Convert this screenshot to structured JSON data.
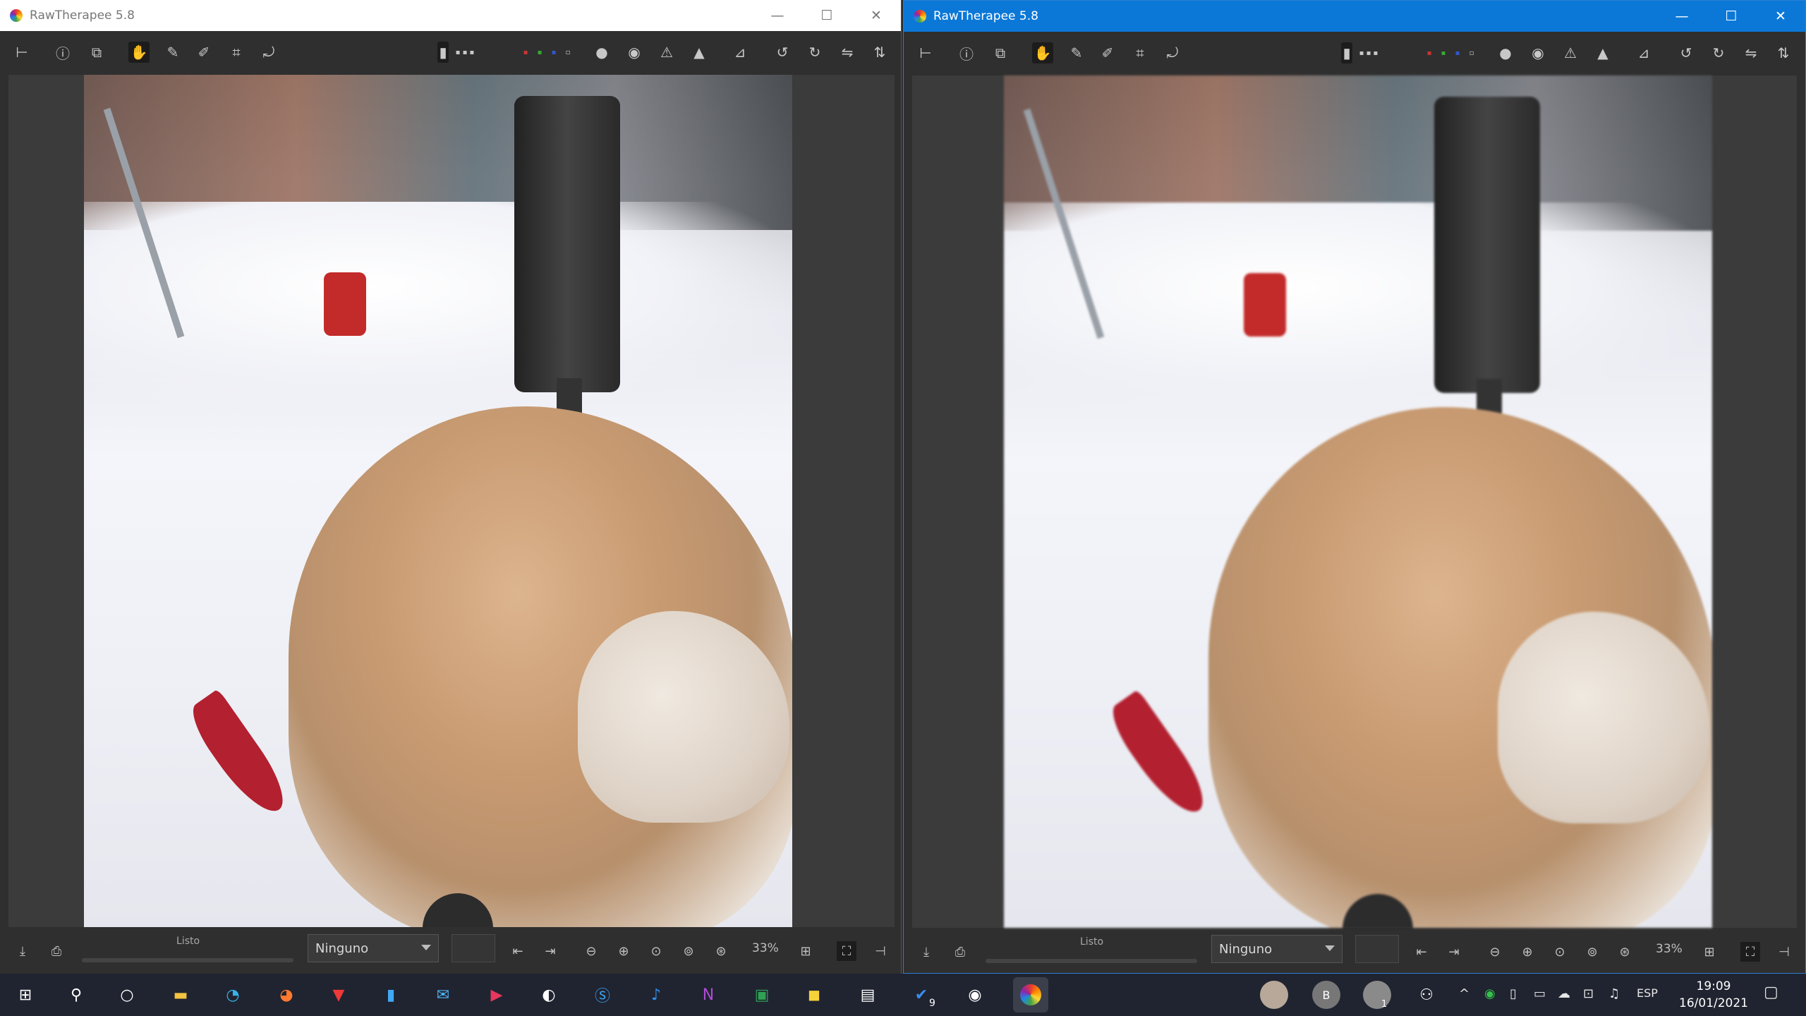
{
  "colors": {
    "title_active": "#0b78d7",
    "title_inactive": "#ffffff",
    "panel_bg": "#2f2f2f",
    "taskbar_bg": "#202430"
  },
  "windows": [
    {
      "title": "RawTherapee 5.8",
      "status_text": "Listo",
      "profile_combo": "Ninguno",
      "zoom_level": "33%"
    },
    {
      "title": "RawTherapee 5.8",
      "status_text": "Listo",
      "profile_combo": "Ninguno",
      "zoom_level": "33%"
    }
  ],
  "window_controls": {
    "minimize": "—",
    "maximize": "☐",
    "close": "✕"
  },
  "toolbar_icons": [
    "hide-history-icon",
    "info-icon",
    "before-after-icon",
    "hand-tool-icon",
    "color-picker-icon",
    "white-balance-picker-icon",
    "crop-icon",
    "straighten-icon",
    "indicator-icon",
    "channel-r-icon",
    "channel-g-icon",
    "channel-b-icon",
    "focus-mask-icon",
    "clipped-highlights-icon",
    "clipped-shadows-icon",
    "clipped-warning-icon",
    "histogram-icon",
    "rotate-left-icon",
    "rotate-right-icon",
    "flip-horizontal-icon",
    "flip-vertical-icon"
  ],
  "taskbar": {
    "apps": [
      "start-icon",
      "search-icon",
      "cortana-icon",
      "file-explorer-icon",
      "edge-icon",
      "firefox-icon",
      "vivaldi-icon",
      "notepad-icon",
      "mail-icon",
      "media-player-icon",
      "app-icon",
      "skype-icon",
      "ditto-icon",
      "onenote-icon",
      "excel-icon",
      "sticky-notes-icon",
      "gallery-icon",
      "todo-icon",
      "photos-icon",
      "rawtherapee-icon"
    ],
    "todo_badge": "9",
    "profile_initial": "B",
    "people_badge": "1",
    "language": "ESP",
    "time": "19:09",
    "date": "16/01/2021"
  }
}
